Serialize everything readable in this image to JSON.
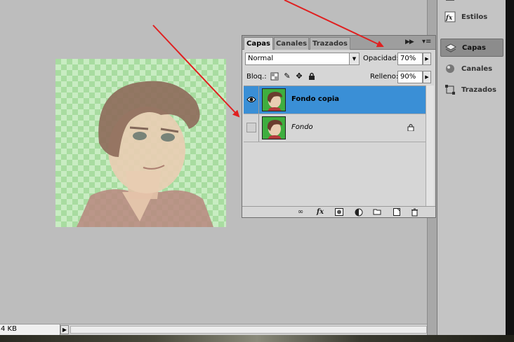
{
  "status_bar": {
    "doc_size": "4 KB",
    "menu_arrow": "▶"
  },
  "layers_panel": {
    "tabs": [
      {
        "label": "Capas",
        "active": true
      },
      {
        "label": "Canales",
        "active": false
      },
      {
        "label": "Trazados",
        "active": false
      }
    ],
    "blend_mode": "Normal",
    "opacity_label": "Opacidad:",
    "opacity_value": "70%",
    "lock_label": "Bloq.:",
    "fill_label": "Relleno:",
    "fill_value": "90%",
    "layers": [
      {
        "name": "Fondo copia",
        "visible": true,
        "selected": true,
        "locked": false
      },
      {
        "name": "Fondo",
        "visible": false,
        "selected": false,
        "locked": true
      }
    ]
  },
  "dock": {
    "items": [
      {
        "label": "Estilos",
        "icon": "styles-icon",
        "active": false
      },
      {
        "label": "Capas",
        "icon": "layers-icon",
        "active": true
      },
      {
        "label": "Canales",
        "icon": "channels-icon",
        "active": false
      },
      {
        "label": "Trazados",
        "icon": "paths-icon",
        "active": false
      }
    ]
  },
  "colors": {
    "selection": "#3a8fd6",
    "annotation_arrow": "#e02020",
    "canvas_bg": "#bdbdbd"
  }
}
